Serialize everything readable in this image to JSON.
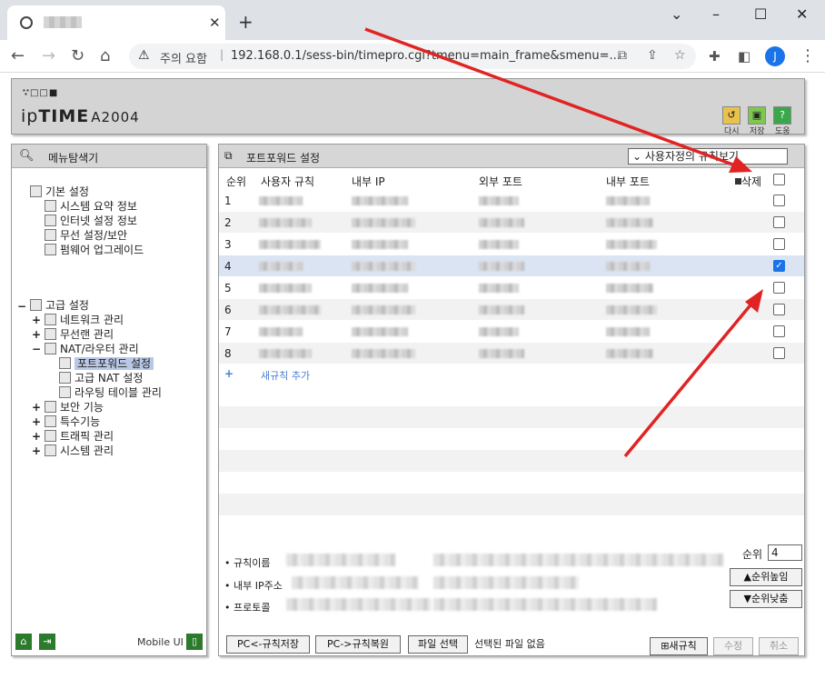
{
  "browser": {
    "tab_title": "",
    "new_tab": "+",
    "window_controls": [
      "⌄",
      "–",
      "☐",
      "✕"
    ],
    "address_warning": "주의 요함",
    "url": "192.168.0.1/sess-bin/timepro.cgi?tmenu=main_frame&smenu=...",
    "profile_initial": "J"
  },
  "header": {
    "logo_dots": "∵□□■",
    "logo_ip": "ip",
    "logo_time": "TIME",
    "model": "A2004",
    "buttons": [
      {
        "label": "다시",
        "icon": "refresh-icon"
      },
      {
        "label": "저장",
        "icon": "save-icon"
      },
      {
        "label": "도움",
        "icon": "help-icon"
      }
    ]
  },
  "left": {
    "title": "메뉴탐색기",
    "basic": {
      "label": "기본 설정",
      "items": [
        "시스템 요약 정보",
        "인터넷 설정 정보",
        "무선 설정/보안",
        "펌웨어 업그레이드"
      ]
    },
    "advanced": {
      "label": "고급 설정",
      "collapse": "−",
      "items": [
        {
          "label": "네트워크 관리",
          "exp": "+"
        },
        {
          "label": "무선랜 관리",
          "exp": "+"
        },
        {
          "label": "NAT/라우터 관리",
          "exp": "−"
        },
        {
          "label": "보안 기능",
          "exp": "+"
        },
        {
          "label": "특수기능",
          "exp": "+"
        },
        {
          "label": "트래픽 관리",
          "exp": "+"
        },
        {
          "label": "시스템 관리",
          "exp": "+"
        }
      ],
      "nat_children": [
        "포트포워드 설정",
        "고급 NAT 설정",
        "라우팅 테이블 관리"
      ]
    },
    "mobile_ui": "Mobile UI"
  },
  "right": {
    "title": "포트포워드 설정",
    "view_select": "사용자정의 규칙보기",
    "columns": [
      "순위",
      "사용자 규칙",
      "내부 IP",
      "외부 포트",
      "내부 포트",
      "삭제"
    ],
    "rows": [
      {
        "n": "1",
        "checked": false
      },
      {
        "n": "2",
        "checked": false
      },
      {
        "n": "3",
        "checked": false
      },
      {
        "n": "4",
        "checked": true
      },
      {
        "n": "5",
        "checked": false
      },
      {
        "n": "6",
        "checked": false
      },
      {
        "n": "7",
        "checked": false
      },
      {
        "n": "8",
        "checked": false
      }
    ],
    "add_rule_plus": "+",
    "add_rule": "새규칙 추가",
    "form": {
      "rule_name": "• 규칙이름",
      "internal_ip": "• 내부 IP주소",
      "protocol": "• 프로토콜",
      "rank_label": "순위",
      "rank_value": "4",
      "rank_up": "▲순위높임",
      "rank_down": "▼순위낮춤"
    },
    "bottom": {
      "save_pc": "PC<-규칙저장",
      "restore_pc": "PC->규칙복원",
      "file_select": "파일 선택",
      "no_file": "선택된 파일 없음",
      "new_rule": "새규칙",
      "modify": "수정",
      "cancel": "취소"
    }
  },
  "colors": {
    "arrow": "#e02424",
    "highlight_row": "#dbe4f3",
    "checkbox_on": "#1a73e8"
  }
}
